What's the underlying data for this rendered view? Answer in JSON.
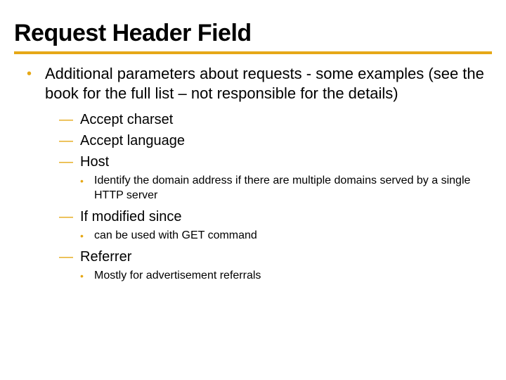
{
  "title": "Request Header Field",
  "main": {
    "text": "Additional parameters about requests - some examples (see the book for the full list – not responsible for the details)"
  },
  "items": [
    {
      "label": "Accept charset"
    },
    {
      "label": "Accept language"
    },
    {
      "label": "Host",
      "sub": "Identify the domain address if there are multiple domains served by a single HTTP server"
    },
    {
      "label": "If modified since",
      "sub": "can be used with GET command"
    },
    {
      "label": "Referrer",
      "sub": "Mostly for advertisement referrals"
    }
  ]
}
